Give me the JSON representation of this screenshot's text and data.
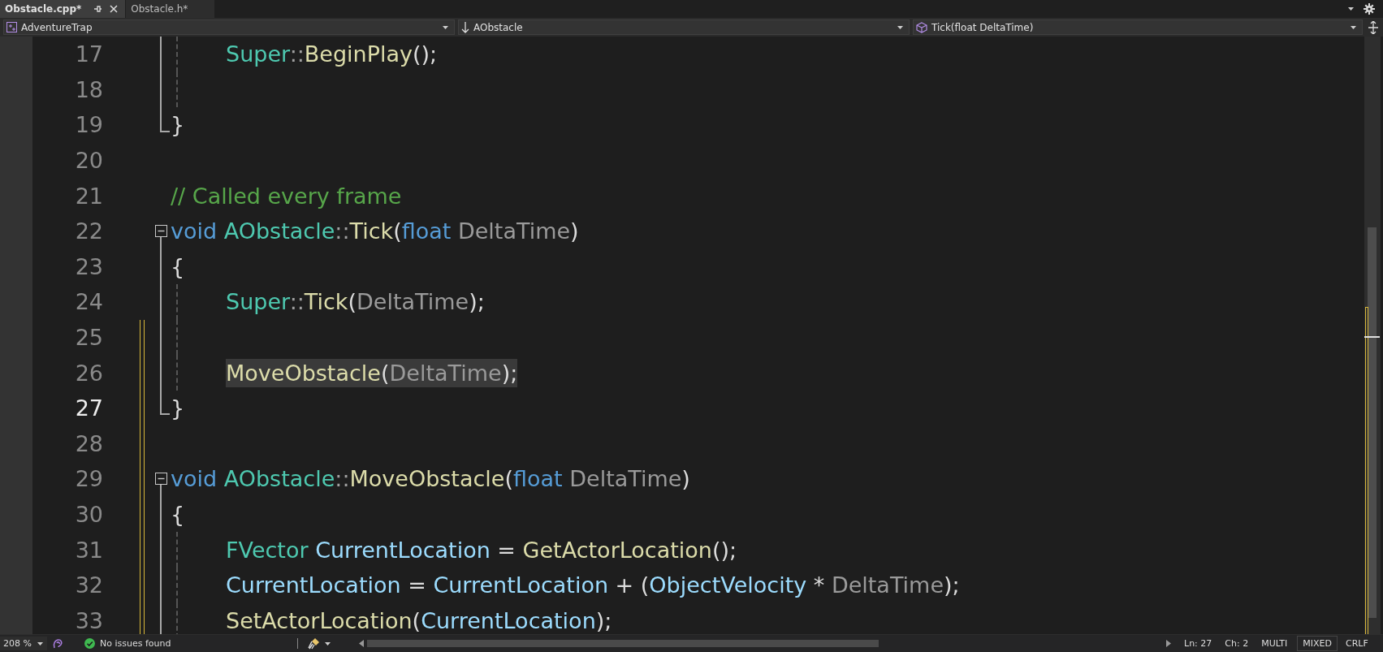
{
  "tabs": [
    {
      "label": "Obstacle.cpp*",
      "selected": true,
      "pinnable": true,
      "closable": true
    },
    {
      "label": "Obstacle.h*",
      "selected": false,
      "pinnable": false,
      "closable": false
    }
  ],
  "navigation_bar": {
    "dropdowns": [
      {
        "kind": "project",
        "value": "AdventureTrap"
      },
      {
        "kind": "scope",
        "value": "AObstacle"
      },
      {
        "kind": "member",
        "value": "Tick(float DeltaTime)"
      }
    ]
  },
  "editor": {
    "lines": [
      {
        "number": "17",
        "in_block": true,
        "block_end": false,
        "collapsible": false,
        "indent_guide": true,
        "changed": false,
        "tokens": [
          {
            "kind": "type",
            "text": "    Super"
          },
          {
            "kind": "punct",
            "text": "::"
          },
          {
            "kind": "func",
            "text": "BeginPlay"
          },
          {
            "kind": "plain",
            "text": "();"
          }
        ]
      },
      {
        "number": "18",
        "in_block": true,
        "block_end": false,
        "collapsible": false,
        "indent_guide": true,
        "changed": false
      },
      {
        "number": "19",
        "in_block": true,
        "block_end": true,
        "collapsible": false,
        "indent_guide": false,
        "changed": false,
        "tokens": [
          {
            "kind": "plain",
            "text": "}"
          }
        ]
      },
      {
        "number": "20",
        "in_block": false,
        "block_end": false,
        "collapsible": false,
        "indent_guide": false,
        "changed": false
      },
      {
        "number": "21",
        "in_block": false,
        "block_end": false,
        "collapsible": false,
        "indent_guide": false,
        "changed": false,
        "tokens": [
          {
            "kind": "comment",
            "text": "// Called every frame"
          }
        ]
      },
      {
        "number": "22",
        "in_block": false,
        "block_end": false,
        "collapsible": true,
        "indent_guide": false,
        "changed": false,
        "tokens": [
          {
            "kind": "keyword",
            "text": "void "
          },
          {
            "kind": "type",
            "text": "AObstacle"
          },
          {
            "kind": "punct",
            "text": "::"
          },
          {
            "kind": "func",
            "text": "Tick"
          },
          {
            "kind": "plain",
            "text": "("
          },
          {
            "kind": "keyword",
            "text": "float "
          },
          {
            "kind": "param",
            "text": "DeltaTime"
          },
          {
            "kind": "plain",
            "text": ")"
          }
        ]
      },
      {
        "number": "23",
        "in_block": true,
        "block_end": false,
        "collapsible": false,
        "indent_guide": false,
        "changed": false,
        "tokens": [
          {
            "kind": "plain",
            "text": "{"
          }
        ]
      },
      {
        "number": "24",
        "in_block": true,
        "block_end": false,
        "collapsible": false,
        "indent_guide": true,
        "changed": false,
        "tokens": [
          {
            "kind": "type",
            "text": "    Super"
          },
          {
            "kind": "punct",
            "text": "::"
          },
          {
            "kind": "func",
            "text": "Tick"
          },
          {
            "kind": "plain",
            "text": "("
          },
          {
            "kind": "param",
            "text": "DeltaTime"
          },
          {
            "kind": "plain",
            "text": ");"
          }
        ]
      },
      {
        "number": "25",
        "in_block": true,
        "block_end": false,
        "collapsible": false,
        "indent_guide": true,
        "changed": true
      },
      {
        "number": "26",
        "in_block": true,
        "block_end": false,
        "collapsible": false,
        "indent_guide": true,
        "changed": true,
        "highlighted": true,
        "tokens": [
          {
            "kind": "func",
            "text": "    MoveObstacle"
          },
          {
            "kind": "plain",
            "text": "("
          },
          {
            "kind": "param",
            "text": "DeltaTime"
          },
          {
            "kind": "plain",
            "text": ");"
          }
        ]
      },
      {
        "number": "27",
        "in_block": true,
        "block_end": true,
        "collapsible": false,
        "indent_guide": false,
        "changed": true,
        "current": true,
        "tokens": [
          {
            "kind": "plain",
            "text": "}"
          }
        ]
      },
      {
        "number": "28",
        "in_block": false,
        "block_end": false,
        "collapsible": false,
        "indent_guide": false,
        "changed": true
      },
      {
        "number": "29",
        "in_block": false,
        "block_end": false,
        "collapsible": true,
        "indent_guide": false,
        "changed": true,
        "tokens": [
          {
            "kind": "keyword",
            "text": "void "
          },
          {
            "kind": "type",
            "text": "AObstacle"
          },
          {
            "kind": "punct",
            "text": "::"
          },
          {
            "kind": "func",
            "text": "MoveObstacle"
          },
          {
            "kind": "plain",
            "text": "("
          },
          {
            "kind": "keyword",
            "text": "float "
          },
          {
            "kind": "param",
            "text": "DeltaTime"
          },
          {
            "kind": "plain",
            "text": ")"
          }
        ]
      },
      {
        "number": "30",
        "in_block": true,
        "block_end": false,
        "collapsible": false,
        "indent_guide": false,
        "changed": true,
        "tokens": [
          {
            "kind": "plain",
            "text": "{"
          }
        ]
      },
      {
        "number": "31",
        "in_block": true,
        "block_end": false,
        "collapsible": false,
        "indent_guide": true,
        "changed": true,
        "tokens": [
          {
            "kind": "type",
            "text": "    FVector "
          },
          {
            "kind": "variable",
            "text": "CurrentLocation"
          },
          {
            "kind": "plain",
            "text": " = "
          },
          {
            "kind": "func",
            "text": "GetActorLocation"
          },
          {
            "kind": "plain",
            "text": "();"
          }
        ]
      },
      {
        "number": "32",
        "in_block": true,
        "block_end": false,
        "collapsible": false,
        "indent_guide": true,
        "changed": true,
        "tokens": [
          {
            "kind": "variable",
            "text": "    CurrentLocation"
          },
          {
            "kind": "plain",
            "text": " = "
          },
          {
            "kind": "variable",
            "text": "CurrentLocation"
          },
          {
            "kind": "plain",
            "text": " + ("
          },
          {
            "kind": "variable",
            "text": "ObjectVelocity"
          },
          {
            "kind": "plain",
            "text": " * "
          },
          {
            "kind": "param",
            "text": "DeltaTime"
          },
          {
            "kind": "plain",
            "text": ");"
          }
        ]
      },
      {
        "number": "33",
        "in_block": true,
        "block_end": false,
        "collapsible": false,
        "indent_guide": true,
        "changed": true,
        "tokens": [
          {
            "kind": "func",
            "text": "    SetActorLocation"
          },
          {
            "kind": "plain",
            "text": "("
          },
          {
            "kind": "variable",
            "text": "CurrentLocation"
          },
          {
            "kind": "plain",
            "text": ");"
          }
        ]
      }
    ]
  },
  "status_bar": {
    "zoom": "208 %",
    "issues": "No issues found",
    "line": "Ln: 27",
    "column": "Ch: 2",
    "selection_mode": "MULTI",
    "tabs_mode": "MIXED",
    "line_endings": "CRLF"
  }
}
